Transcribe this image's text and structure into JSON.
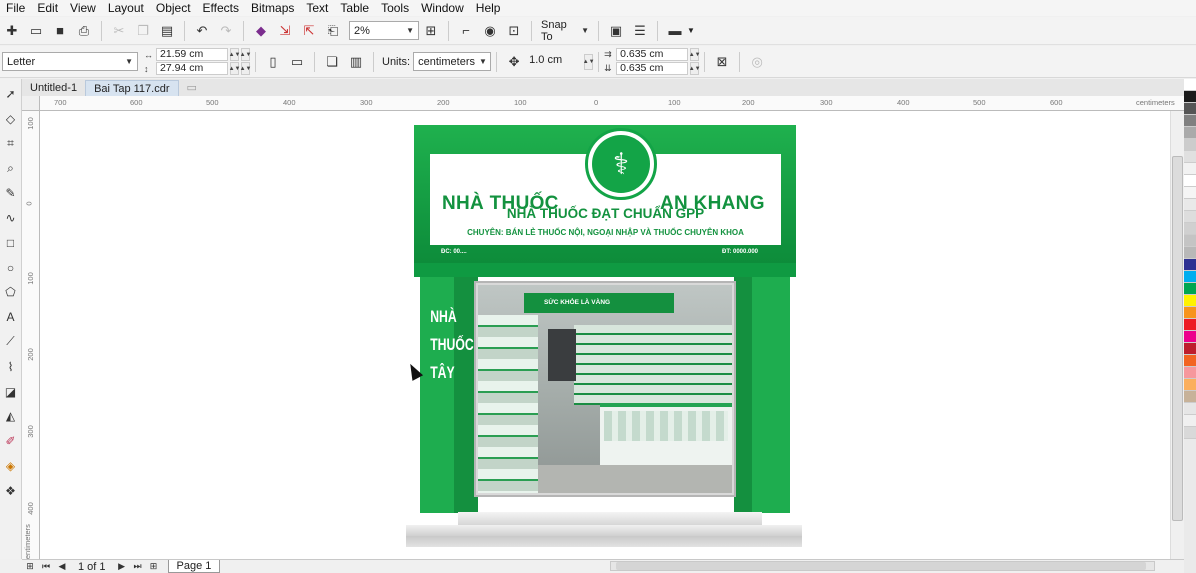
{
  "menu": [
    "File",
    "Edit",
    "View",
    "Layout",
    "Object",
    "Effects",
    "Bitmaps",
    "Text",
    "Table",
    "Tools",
    "Window",
    "Help"
  ],
  "toolbar": {
    "zoom": "2%",
    "snap_to": "Snap To"
  },
  "property_bar": {
    "page_size": "Letter",
    "width": "21.59 cm",
    "height": "27.94 cm",
    "units_label": "Units:",
    "units": "centimeters",
    "nudge": "1.0 cm",
    "dup_x": "0.635 cm",
    "dup_y": "0.635 cm"
  },
  "tabs": [
    {
      "label": "Untitled-1",
      "active": false
    },
    {
      "label": "Bai Tap 117.cdr",
      "active": true
    }
  ],
  "ruler": {
    "h_ticks": [
      "700",
      "600",
      "500",
      "400",
      "300",
      "200",
      "100",
      "0",
      "100",
      "200",
      "300",
      "400",
      "500",
      "600"
    ],
    "h_unit": "centimeters",
    "v_ticks": [
      "100",
      "0",
      "100",
      "200",
      "300",
      "400"
    ],
    "v_unit": "centimeters"
  },
  "drawing": {
    "sign_left": "NHÀ THUỐC",
    "sign_right": "AN KHANG",
    "sign_gpp": "NHÀ THUỐC ĐẠT CHUẨN GPP",
    "sign_spec": "CHUYÊN: BÁN LẺ THUỐC NỘI, NGOẠI NHẬP VÀ THUỐC CHUYÊN KHOA",
    "sign_addr": "ĐC: 00....",
    "sign_phone": "ĐT: 0000.000",
    "pillar_text": [
      "NHÀ",
      "THUỐC",
      "TÂY"
    ],
    "shop_banner": "SỨC KHỎE LÀ VÀNG"
  },
  "status": {
    "page_count": "1 of 1",
    "page_tab": "Page 1"
  },
  "palette_colors": [
    "#ffffff",
    "#1a1a1a",
    "#555555",
    "#808080",
    "#aaaaaa",
    "#cccccc",
    "#e0e0e0",
    "#f2f2f2",
    "#ffffff",
    "#f5f5f5",
    "#e9e9e9",
    "#dddddd",
    "#d0d0d0",
    "#c4c4c4",
    "#b8b8b8",
    "#2e3192",
    "#00aeef",
    "#00a651",
    "#fff200",
    "#f7941d",
    "#ed1c24",
    "#ec008c",
    "#be1e2d",
    "#f26522",
    "#f6989d",
    "#fbaf5d",
    "#c7b299",
    "#e6e6e6",
    "#f0f0f0",
    "#d9d9d9"
  ]
}
